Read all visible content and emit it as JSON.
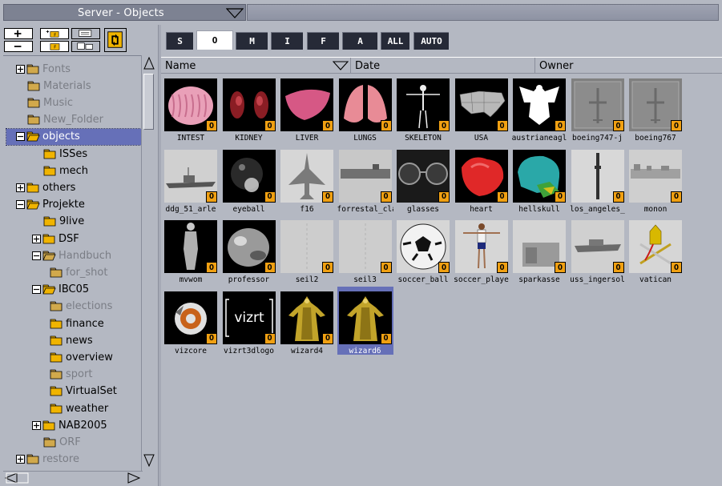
{
  "window": {
    "title": "Server - Objects"
  },
  "tabs": [
    "S",
    "O",
    "M",
    "I",
    "F",
    "A",
    "ALL",
    "AUTO"
  ],
  "active_tab": "O",
  "columns": [
    "Name",
    "Date",
    "Owner"
  ],
  "badge": "O",
  "tree": [
    {
      "label": "Fonts",
      "dim": true,
      "expander": "plus",
      "indent": 0
    },
    {
      "label": "Materials",
      "dim": true,
      "expander": "none",
      "indent": 0
    },
    {
      "label": "Music",
      "dim": true,
      "expander": "none",
      "indent": 0
    },
    {
      "label": "New_Folder",
      "dim": true,
      "expander": "none",
      "indent": 0
    },
    {
      "label": "objects",
      "dim": false,
      "expander": "minus",
      "indent": 0,
      "selected": true
    },
    {
      "label": "ISSes",
      "dim": false,
      "expander": "none",
      "indent": 1
    },
    {
      "label": "mech",
      "dim": false,
      "expander": "none",
      "indent": 1
    },
    {
      "label": "others",
      "dim": false,
      "expander": "plus",
      "indent": 0
    },
    {
      "label": "Projekte",
      "dim": false,
      "expander": "minus",
      "indent": 0
    },
    {
      "label": "9live",
      "dim": false,
      "expander": "none",
      "indent": 1
    },
    {
      "label": "DSF",
      "dim": false,
      "expander": "plus",
      "indent": 1
    },
    {
      "label": "Handbuch",
      "dim": true,
      "expander": "minus",
      "indent": 1
    },
    {
      "label": "for_shot",
      "dim": true,
      "expander": "none",
      "indent": 2
    },
    {
      "label": "IBC05",
      "dim": false,
      "expander": "minus",
      "indent": 1
    },
    {
      "label": "elections",
      "dim": true,
      "expander": "none",
      "indent": 2
    },
    {
      "label": "finance",
      "dim": false,
      "expander": "none",
      "indent": 2
    },
    {
      "label": "news",
      "dim": false,
      "expander": "none",
      "indent": 2
    },
    {
      "label": "overview",
      "dim": false,
      "expander": "none",
      "indent": 2
    },
    {
      "label": "sport",
      "dim": true,
      "expander": "none",
      "indent": 2
    },
    {
      "label": "VirtualSet",
      "dim": false,
      "expander": "none",
      "indent": 2
    },
    {
      "label": "weather",
      "dim": false,
      "expander": "none",
      "indent": 2
    },
    {
      "label": "NAB2005",
      "dim": false,
      "expander": "plus",
      "indent": 1
    },
    {
      "label": "ORF",
      "dim": true,
      "expander": "none",
      "indent": 1
    },
    {
      "label": "restore",
      "dim": true,
      "expander": "plus",
      "indent": 0
    }
  ],
  "objects": [
    {
      "name": "INTEST",
      "thumb": "brain"
    },
    {
      "name": "KIDNEY",
      "thumb": "kidney"
    },
    {
      "name": "LIVER",
      "thumb": "liver"
    },
    {
      "name": "LUNGS",
      "thumb": "lungs"
    },
    {
      "name": "SKELETON",
      "thumb": "skeleton"
    },
    {
      "name": "USA",
      "thumb": "usa"
    },
    {
      "name": "austrianeagl",
      "thumb": "eagle"
    },
    {
      "name": "boeing747-j",
      "thumb": "plane"
    },
    {
      "name": "boeing767",
      "thumb": "plane"
    },
    {
      "name": "ddg_51_arle",
      "thumb": "ship"
    },
    {
      "name": "eyeball",
      "thumb": "eyeball"
    },
    {
      "name": "f16",
      "thumb": "jet"
    },
    {
      "name": "forrestal_cla",
      "thumb": "carrier"
    },
    {
      "name": "glasses",
      "thumb": "glasses"
    },
    {
      "name": "heart",
      "thumb": "heart"
    },
    {
      "name": "hellskull",
      "thumb": "skull"
    },
    {
      "name": "los_angeles_",
      "thumb": "sub"
    },
    {
      "name": "monon",
      "thumb": "train"
    },
    {
      "name": "mvwom",
      "thumb": "woman"
    },
    {
      "name": "professor",
      "thumb": "professor"
    },
    {
      "name": "seil2",
      "thumb": "seil"
    },
    {
      "name": "seil3",
      "thumb": "seil"
    },
    {
      "name": "soccer_ball",
      "thumb": "ball"
    },
    {
      "name": "soccer_playe",
      "thumb": "player"
    },
    {
      "name": "sparkasse",
      "thumb": "sparkasse"
    },
    {
      "name": "uss_ingersol",
      "thumb": "ship2"
    },
    {
      "name": "vatican",
      "thumb": "vatican"
    },
    {
      "name": "vizcore",
      "thumb": "vizcore"
    },
    {
      "name": "vizrt3dlogo",
      "thumb": "vizrt"
    },
    {
      "name": "wizard4",
      "thumb": "wizard"
    },
    {
      "name": "wizard6",
      "thumb": "wizard",
      "selected": true
    }
  ],
  "logo_text": "vizrt",
  "colors": {
    "selection": "#6670b8",
    "badge": "#f0a012",
    "folder": "#f0b400"
  }
}
